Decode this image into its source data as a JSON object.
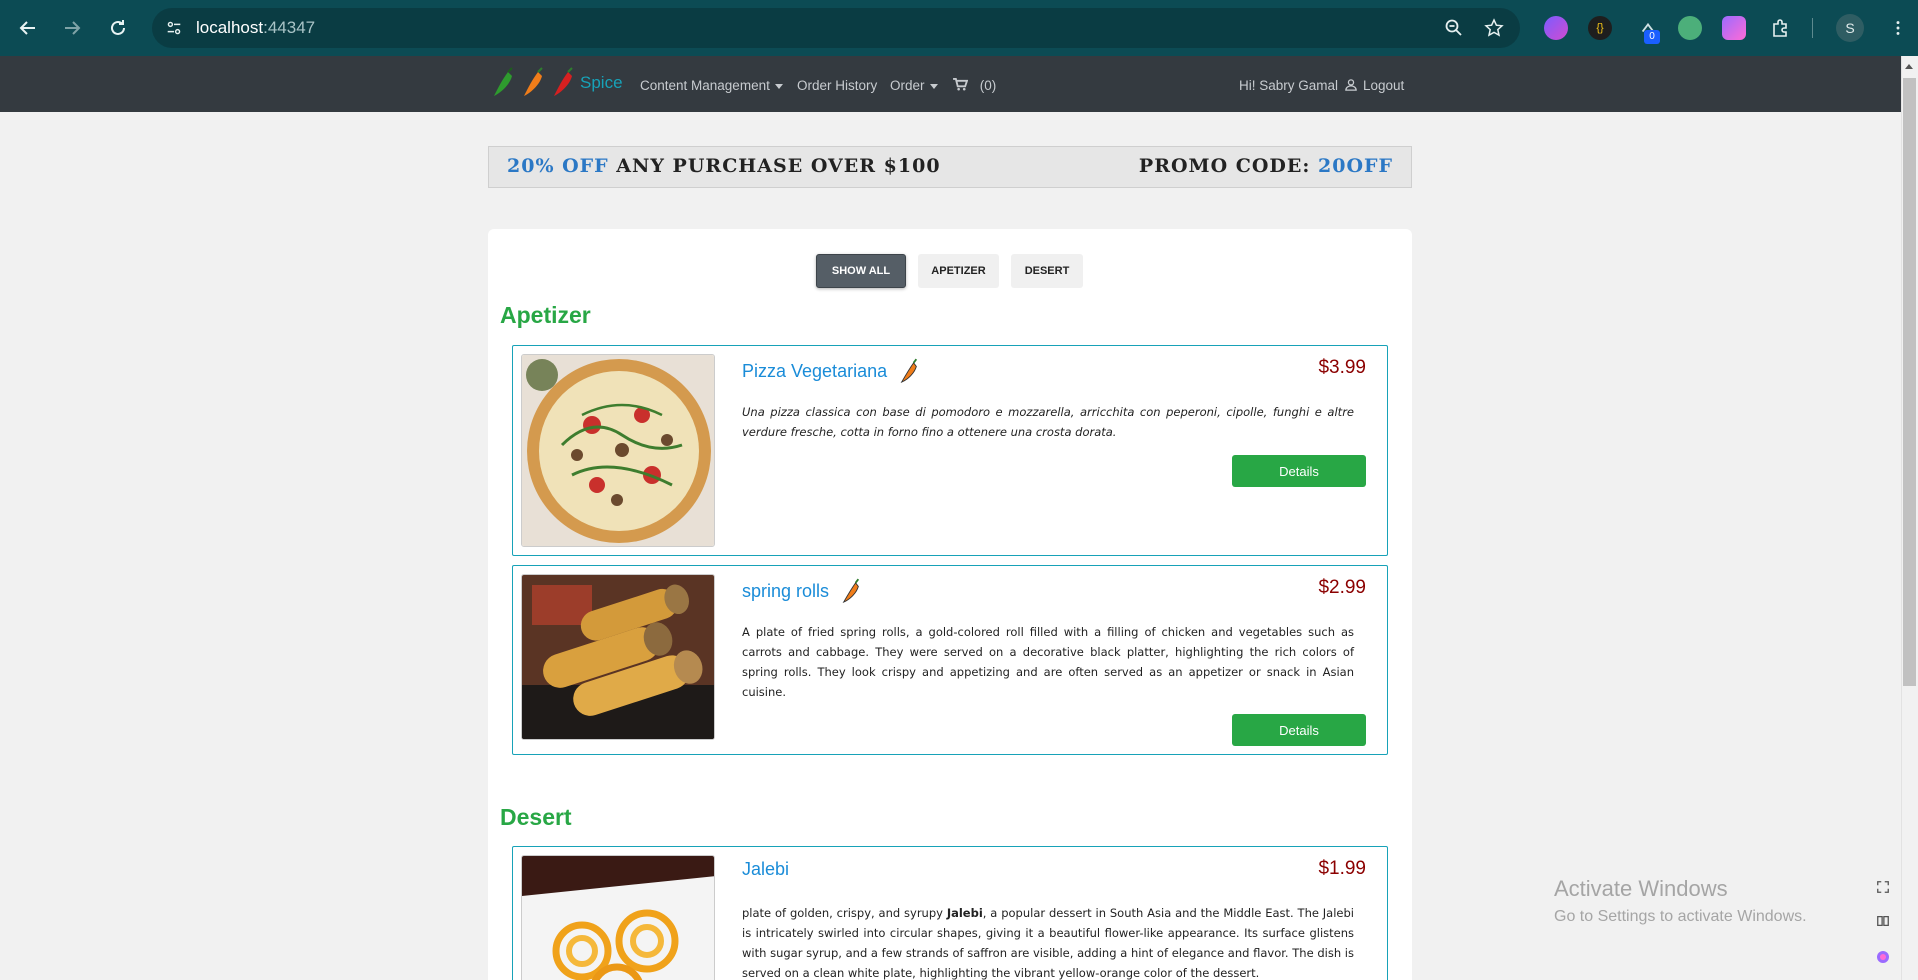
{
  "browser": {
    "url_host": "localhost",
    "url_port": ":44347",
    "extension_badge": "0",
    "profile_initial": "S"
  },
  "navbar": {
    "brand": "Spice",
    "links": {
      "content_management": "Content Management",
      "order_history": "Order History",
      "order": "Order",
      "cart": "(0)"
    },
    "greeting": "Hi! Sabry Gamal",
    "logout": "Logout"
  },
  "promo": {
    "discount": "20% OFF",
    "condition": " ANY PURCHASE OVER $100",
    "code_label": "PROMO CODE: ",
    "code": "20OFF"
  },
  "filters": {
    "show_all": "SHOW ALL",
    "apetizer": "APETIZER",
    "desert": "DESERT"
  },
  "categories": {
    "apetizer": "Apetizer",
    "desert": "Desert"
  },
  "items": [
    {
      "name": "Pizza Vegetariana",
      "price": "$3.99",
      "description": "Una pizza classica con base di pomodoro e mozzarella, arricchita con peperoni, cipolle, funghi e altre verdure fresche, cotta in forno fino a ottenere una crosta dorata.",
      "details": "Details",
      "spicy_icon": "chili-orange-icon"
    },
    {
      "name": "spring rolls",
      "price": "$2.99",
      "description": "A plate of fried spring rolls, a gold-colored roll filled with a filling of chicken and vegetables such as carrots and cabbage. They were served on a decorative black platter, highlighting the rich colors of spring rolls. They look crispy and appetizing and are often served as an appetizer or snack in Asian cuisine.",
      "details": "Details",
      "spicy_icon": "chili-orange-icon"
    },
    {
      "name": "Jalebi",
      "price": "$1.99",
      "description_pre": "plate of golden, crispy, and syrupy ",
      "description_bold": "Jalebi",
      "description_post": ", a popular dessert in South Asia and the Middle East. The Jalebi is intricately swirled into circular shapes, giving it a beautiful flower-like appearance. Its surface glistens with sugar syrup, and a few strands of saffron are visible, adding a hint of elegance and flavor. The dish is served on a clean white plate, highlighting the vibrant yellow-orange color of the dessert."
    }
  ],
  "watermark": {
    "title": "Activate Windows",
    "subtitle": "Go to Settings to activate Windows."
  },
  "colors": {
    "browser_bar": "#0c4b54",
    "navbar": "#343a40",
    "brand": "#17a2b8",
    "category": "#28a745",
    "item_name": "#1a8cd8",
    "price": "#8b0000",
    "details_button": "#28a745"
  }
}
